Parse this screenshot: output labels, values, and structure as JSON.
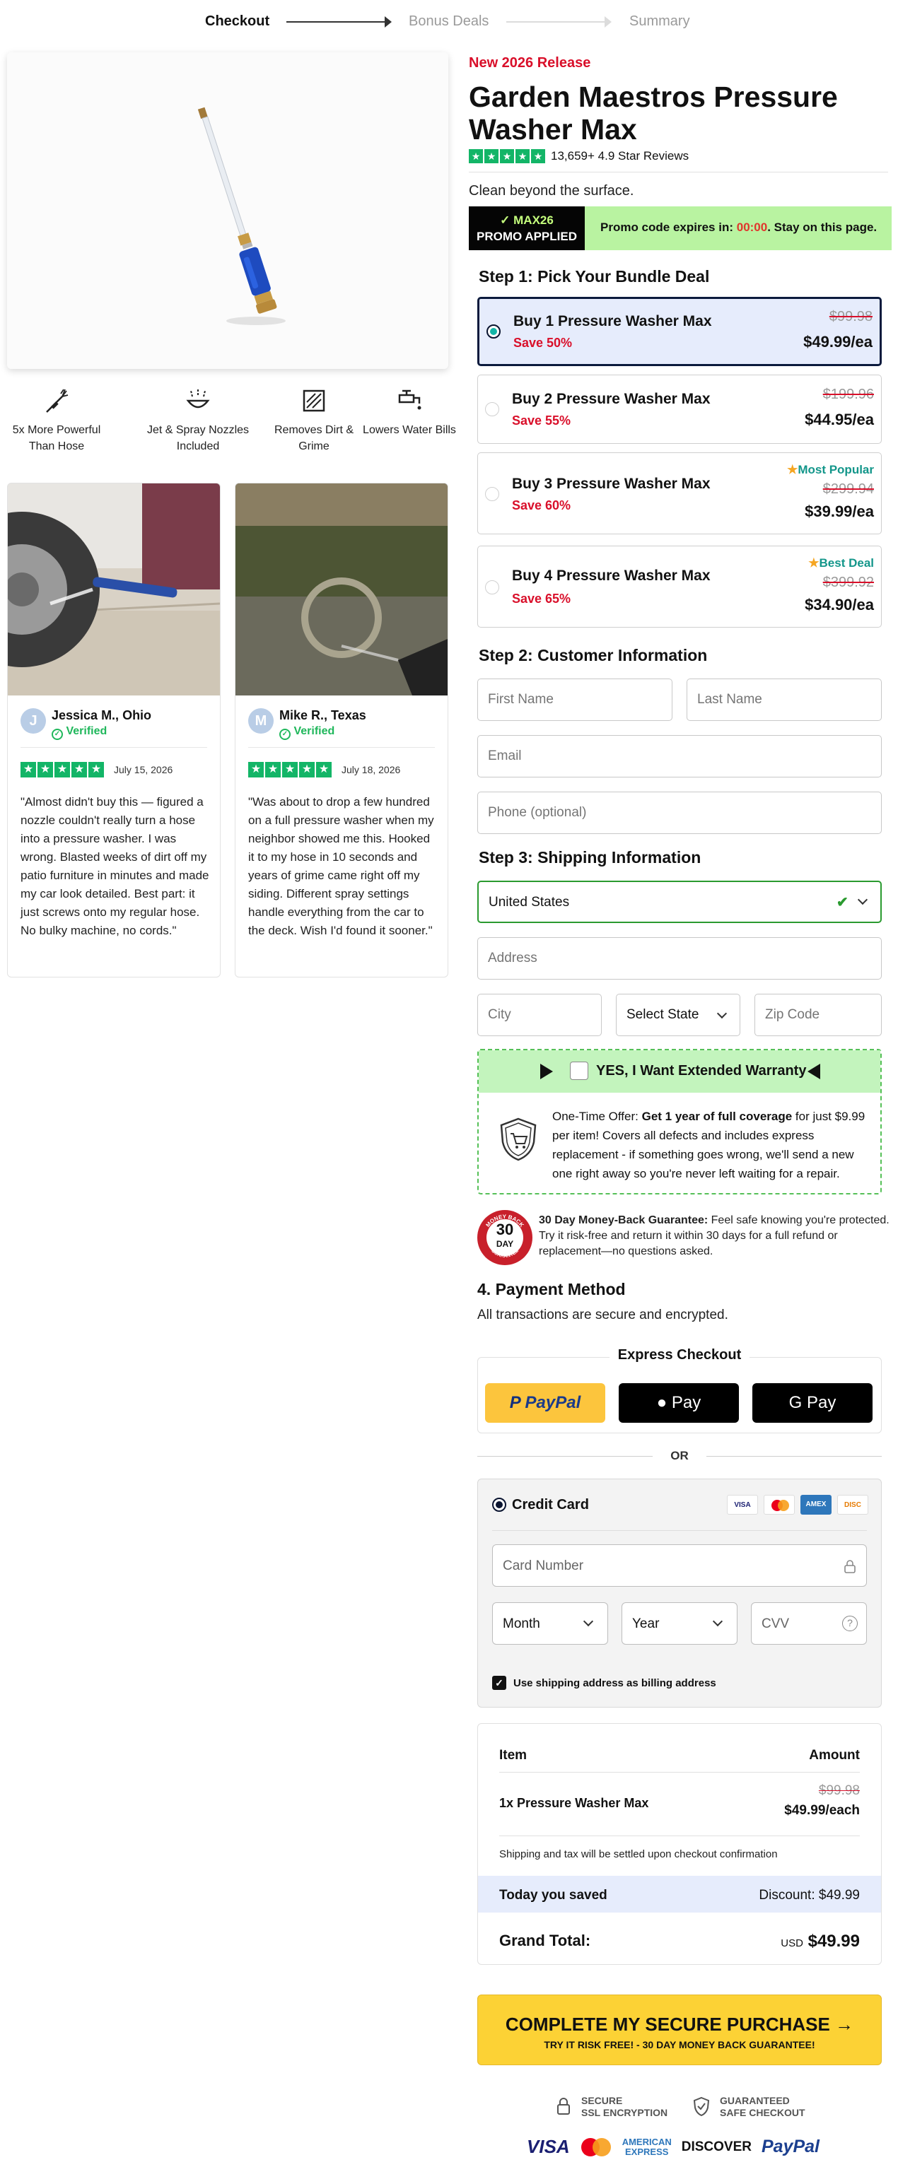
{
  "stepper": {
    "steps": [
      "Checkout",
      "Bonus Deals",
      "Summary"
    ]
  },
  "benefits": [
    {
      "icon": "pressure-spray-icon",
      "label": "5x More Powerful Than Hose"
    },
    {
      "icon": "jet-nozzle-icon",
      "label": "Jet & Spray Nozzles Included"
    },
    {
      "icon": "dirt-removal-icon",
      "label": "Removes Dirt & Grime"
    },
    {
      "icon": "water-tap-icon",
      "label": "Lowers Water Bills"
    }
  ],
  "reviews": [
    {
      "initial": "J",
      "name": "Jessica M., Ohio",
      "verified": "Verified",
      "date": "July 15, 2026",
      "text": "\"Almost didn't buy this — figured a nozzle couldn't really turn a hose into a pressure washer. I was wrong. Blasted weeks of dirt off my patio furniture in minutes and made my car look detailed. Best part: it just screws onto my regular hose. No bulky machine, no cords.\""
    },
    {
      "initial": "M",
      "name": "Mike R., Texas",
      "verified": "Verified",
      "date": "July 18, 2026",
      "text": "\"Was about to drop a few hundred on a full pressure washer when my neighbor showed me this. Hooked it to my hose in 10 seconds and years of grime came right off my siding. Different spray settings handle everything from the car to the deck. Wish I'd found it sooner.\""
    }
  ],
  "product": {
    "badge": "New 2026 Release",
    "title": "Garden Maestros Pressure Washer Max",
    "rating_text": "13,659+ 4.9 Star Reviews",
    "rating_value": 4.9,
    "tagline": "Clean beyond the surface."
  },
  "promo": {
    "code": "✓ MAX26",
    "applied": "PROMO APPLIED",
    "text_before": "Promo code expires in: ",
    "timer": "00:00",
    "text_after": ". Stay on this page."
  },
  "step1": {
    "heading": "Step 1: Pick Your Bundle Deal",
    "bundles": [
      {
        "name": "Buy 1 Pressure Washer Max",
        "save": "Save 50%",
        "old": "$99.98",
        "price": "$49.99/ea",
        "tag": "",
        "selected": true
      },
      {
        "name": "Buy 2 Pressure Washer Max",
        "save": "Save 55%",
        "old": "$199.96",
        "price": "$44.95/ea",
        "tag": "",
        "selected": false
      },
      {
        "name": "Buy 3 Pressure Washer Max",
        "save": "Save 60%",
        "old": "$299.94",
        "price": "$39.99/ea",
        "tag": "Most Popular",
        "selected": false
      },
      {
        "name": "Buy 4 Pressure Washer Max",
        "save": "Save 65%",
        "old": "$399.92",
        "price": "$34.90/ea",
        "tag": "Best Deal",
        "selected": false
      }
    ]
  },
  "step2": {
    "heading": "Step 2: Customer Information",
    "first_name": "First Name",
    "last_name": "Last Name",
    "email": "Email",
    "phone": "Phone (optional)"
  },
  "step3": {
    "heading": "Step 3: Shipping Information",
    "country": "United States",
    "address": "Address",
    "city": "City",
    "state": "Select State",
    "zip": "Zip Code"
  },
  "warranty": {
    "label": "YES, I Want Extended Warranty",
    "prefix": "One-Time Offer: ",
    "bold": "Get 1 year of full coverage",
    "rest": " for just $9.99 per item! Covers all defects and includes express replacement - if something goes wrong, we'll send a new one right away so you're never left waiting for a repair."
  },
  "guarantee": {
    "seal_top": "MONEY BACK",
    "seal_num": "30",
    "seal_day": "DAY",
    "seal_bottom": "GUARANTEE",
    "bold": "30 Day Money-Back Guarantee:",
    "text": " Feel safe knowing you're protected. Try it risk-free and return it within 30 days for a full refund or replacement—no questions asked."
  },
  "payment": {
    "heading": "4. Payment Method",
    "sub": "All transactions are secure and encrypted.",
    "express_label": "Express Checkout",
    "paypal": "PayPal",
    "applepay": " Pay",
    "googlepay": "G Pay",
    "or": "OR",
    "cc_label": "Credit Card",
    "card_logos": [
      "VISA",
      "MC",
      "AMEX",
      "DISC"
    ],
    "card_number": "Card Number",
    "month": "Month",
    "year": "Year",
    "cvv": "CVV",
    "billing": "Use shipping address as billing address"
  },
  "summary": {
    "item_header": "Item",
    "amount_header": "Amount",
    "item": "1x Pressure Washer Max",
    "old": "$99.98",
    "price": "$49.99/each",
    "shipping_note": "Shipping and tax will be settled upon checkout confirmation",
    "saved_label": "Today you saved",
    "discount": "Discount: $49.99",
    "grand_label": "Grand Total:",
    "currency": "USD",
    "grand_value": "$49.99"
  },
  "cta": {
    "main": "COMPLETE MY SECURE PURCHASE →",
    "sub": "TRY IT RISK FREE! - 30 DAY MONEY BACK GUARANTEE!"
  },
  "trust": {
    "ssl_1": "SECURE",
    "ssl_2": "SSL ENCRYPTION",
    "safe_1": "GUARANTEED",
    "safe_2": "SAFE CHECKOUT",
    "visa": "VISA",
    "amex_1": "AMERICAN",
    "amex_2": "EXPRESS",
    "discover": "DISCOVER",
    "paypal": "PayPal"
  },
  "colors": {
    "accent_red": "#d90f2a",
    "star_green": "#13b567",
    "promo_green": "#b9f3a1",
    "cta_yellow": "#fcd235",
    "selected_blue": "#e6ecfc"
  }
}
